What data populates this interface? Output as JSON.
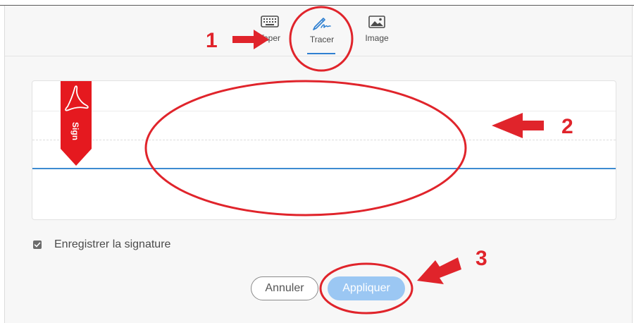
{
  "tabs": [
    {
      "label": "Taper",
      "icon": "keyboard-icon"
    },
    {
      "label": "Tracer",
      "icon": "pen-signature-icon",
      "active": true
    },
    {
      "label": "Image",
      "icon": "image-icon"
    }
  ],
  "signature_pad": {
    "badge_text": "Sign",
    "badge_icon": "acrobat-logo-icon"
  },
  "save_signature": {
    "label": "Enregistrer la signature",
    "checked": true
  },
  "buttons": {
    "cancel": "Annuler",
    "apply": "Appliquer"
  },
  "annotations": {
    "step1": "1",
    "step2": "2",
    "step3": "3"
  },
  "colors": {
    "accent": "#2f80d1",
    "apply_button": "#9bc7f3",
    "annotation_red": "#e0242b"
  }
}
